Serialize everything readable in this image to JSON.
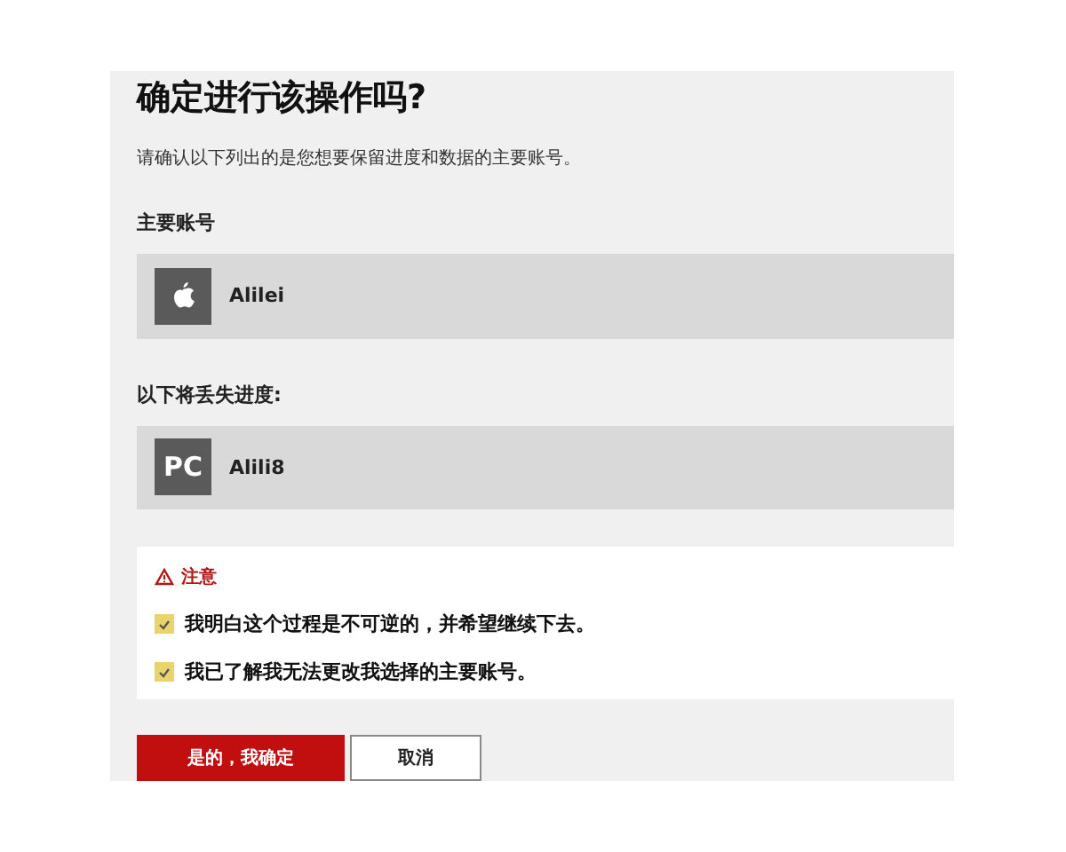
{
  "title": "确定进行该操作吗?",
  "description": "请确认以下列出的是您想要保留进度和数据的主要账号。",
  "sections": [
    {
      "label": "主要账号",
      "account": {
        "kind": "apple",
        "name": "Alilei"
      }
    },
    {
      "label": "以下将丢失进度:",
      "account": {
        "kind": "pc",
        "badge": "PC",
        "name": "Alili8"
      }
    }
  ],
  "notice": {
    "heading": "注意",
    "checks": [
      {
        "label": "我明白这个过程是不可逆的，并希望继续下去。",
        "checked": true
      },
      {
        "label": "我已了解我无法更改我选择的主要账号。",
        "checked": true
      }
    ]
  },
  "buttons": [
    {
      "label": "是的，我确定",
      "kind": "primary"
    },
    {
      "label": "取消",
      "kind": "secondary"
    }
  ]
}
